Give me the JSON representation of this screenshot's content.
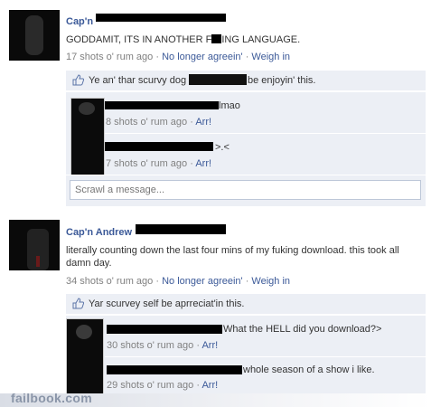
{
  "post1": {
    "author": "Cap'n",
    "text": "GODDAMIT, ITS IN ANOTHER F",
    "text_tail": "ING LANGUAGE.",
    "meta_time": "17 shots o' rum ago",
    "meta_sep": "·",
    "unlike": "No longer agreein'",
    "comment": "Weigh in",
    "likes_prefix": "Ye an' thar scurvy dog",
    "likes_suffix": "be enjoyin' this.",
    "comments": [
      {
        "text": "lmao",
        "time": "8 shots o' rum ago",
        "sep": "·",
        "action": "Arr!"
      },
      {
        "text": ">.<",
        "time": "7 shots o' rum ago",
        "sep": "·",
        "action": "Arr!"
      }
    ],
    "scrawl_placeholder": "Scrawl a message..."
  },
  "post2": {
    "author": "Cap'n Andrew",
    "text_line1_a": "literally counting down the last four mins of my fu",
    "text_line1_b": "king download. this took all",
    "text_line2": "damn day.",
    "meta_time": "34 shots o' rum ago",
    "meta_sep": "·",
    "unlike": "No longer agreein'",
    "comment": "Weigh in",
    "likes_text": "Yar scurvey self be aprreciat'in this.",
    "comments": [
      {
        "text": "What the HELL did you download?>",
        "time": "30 shots o' rum ago",
        "sep": "·",
        "action": "Arr!"
      },
      {
        "text": "whole season of a show i like.",
        "time": "29 shots o' rum ago",
        "sep": "·",
        "action": "Arr!"
      }
    ]
  },
  "footer": {
    "brand": "failbook.com"
  },
  "colors": {
    "link": "#3b5998",
    "meta": "#808080",
    "comment_bg": "#eceff5"
  },
  "icons": [
    "thumbs-up-icon"
  ]
}
